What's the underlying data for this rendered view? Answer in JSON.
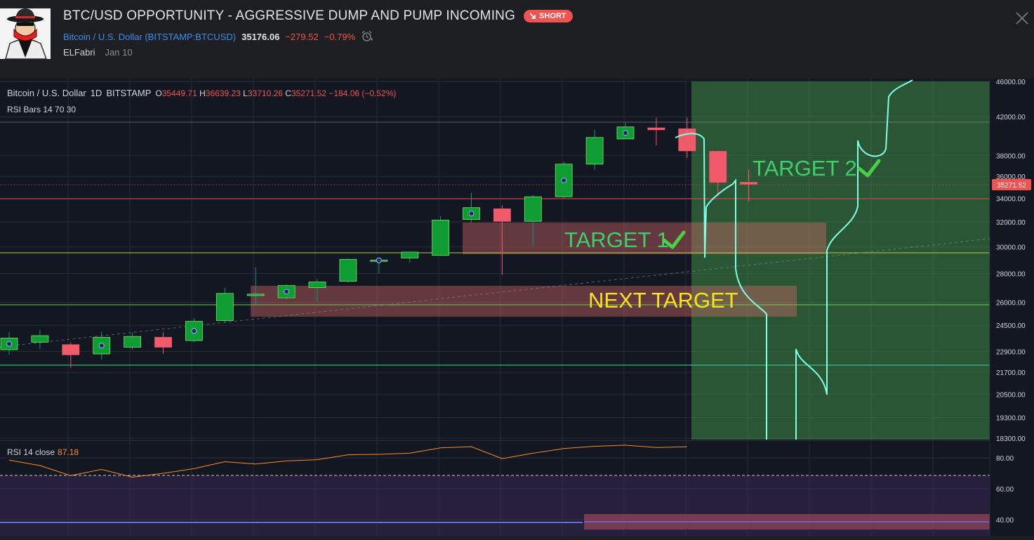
{
  "idea": {
    "title": "BTC/USD OPPORTUNITY - AGGRESSIVE DUMP AND PUMP INCOMING",
    "badge": "SHORT",
    "symbol_name": "Bitcoin / U.S. Dollar",
    "symbol_code": "BITSTAMP:BTCUSD",
    "price": "35176.06",
    "change": "−279.52",
    "change_pct": "−0.79%",
    "author": "ELFabri",
    "date": "Jan 10"
  },
  "chart_legend": {
    "symbol": "Bitcoin / U.S. Dollar",
    "interval": "1D",
    "exchange": "BITSTAMP",
    "o": "35449.71",
    "h": "36639.23",
    "l": "33710.26",
    "c": "35271.52",
    "chg": "−184.06 (−0.52%)",
    "indicator": "RSI Bars 14 70 30"
  },
  "rsi_legend": {
    "label": "RSI 14 close",
    "value": "87.18"
  },
  "colors": {
    "up": "#089981",
    "up_fill": "#0f9d33",
    "down": "#f05a6b",
    "rsi": "#ff8c2a",
    "projection": "#7fffe4",
    "accent": "#2962ff",
    "green_zone": "#4caf50"
  },
  "chart_data": {
    "type": "candlestick",
    "y_scale": "log",
    "ylim": [
      18300,
      46000
    ],
    "y_ticks": [
      "46000.00",
      "42000.00",
      "38000.00",
      "36000.00",
      "34000.00",
      "32000.00",
      "30000.00",
      "28000.00",
      "26000.00",
      "24500.00",
      "22900.00",
      "21700.00",
      "20500.00",
      "19300.00",
      "18300.00"
    ],
    "last_price_label": "35271.52",
    "candles": [
      {
        "o": 23000,
        "h": 24050,
        "l": 22700,
        "c": 23700
      },
      {
        "o": 23450,
        "h": 24200,
        "l": 23050,
        "c": 23850
      },
      {
        "o": 23300,
        "h": 23450,
        "l": 21950,
        "c": 22700
      },
      {
        "o": 22750,
        "h": 24100,
        "l": 22400,
        "c": 23750
      },
      {
        "o": 23150,
        "h": 24050,
        "l": 23000,
        "c": 23800
      },
      {
        "o": 23750,
        "h": 24050,
        "l": 22750,
        "c": 23150
      },
      {
        "o": 23550,
        "h": 24950,
        "l": 23450,
        "c": 24750
      },
      {
        "o": 24800,
        "h": 27000,
        "l": 24650,
        "c": 26600
      },
      {
        "o": 26450,
        "h": 28450,
        "l": 25850,
        "c": 26550
      },
      {
        "o": 26300,
        "h": 27200,
        "l": 26200,
        "c": 27150
      },
      {
        "o": 27000,
        "h": 27600,
        "l": 26050,
        "c": 27400
      },
      {
        "o": 27450,
        "h": 29100,
        "l": 27350,
        "c": 29050
      },
      {
        "o": 28950,
        "h": 29100,
        "l": 28000,
        "c": 29000
      },
      {
        "o": 29150,
        "h": 29400,
        "l": 28800,
        "c": 29600
      },
      {
        "o": 29350,
        "h": 32500,
        "l": 29300,
        "c": 32150
      },
      {
        "o": 32200,
        "h": 34500,
        "l": 31950,
        "c": 33200
      },
      {
        "o": 33100,
        "h": 33400,
        "l": 27900,
        "c": 32050
      },
      {
        "o": 32050,
        "h": 34300,
        "l": 30100,
        "c": 34150
      },
      {
        "o": 34150,
        "h": 37400,
        "l": 34000,
        "c": 37150
      },
      {
        "o": 37150,
        "h": 40600,
        "l": 36600,
        "c": 39800
      },
      {
        "o": 39650,
        "h": 41400,
        "l": 39650,
        "c": 40900
      },
      {
        "o": 40800,
        "h": 41900,
        "l": 39000,
        "c": 40600
      },
      {
        "o": 40700,
        "h": 41900,
        "l": 37750,
        "c": 38450
      },
      {
        "o": 38400,
        "h": 38450,
        "l": 34200,
        "c": 35450
      },
      {
        "o": 35449.71,
        "h": 36639.23,
        "l": 33710.26,
        "c": 35271.52
      }
    ],
    "rsi": {
      "label": "RSI 14 close",
      "ticks": [
        "80.00",
        "60.00",
        "40.00"
      ],
      "values": [
        78.5,
        75,
        68.5,
        72.5,
        67.5,
        70,
        73,
        77.5,
        76,
        78,
        78.8,
        82,
        82.3,
        83,
        86.5,
        87.2,
        79.5,
        83,
        86,
        87.5,
        88.2,
        86.7,
        87.18
      ]
    },
    "annotations": [
      "TARGET 1",
      "TARGET 2",
      "NEXT TARGET"
    ]
  }
}
